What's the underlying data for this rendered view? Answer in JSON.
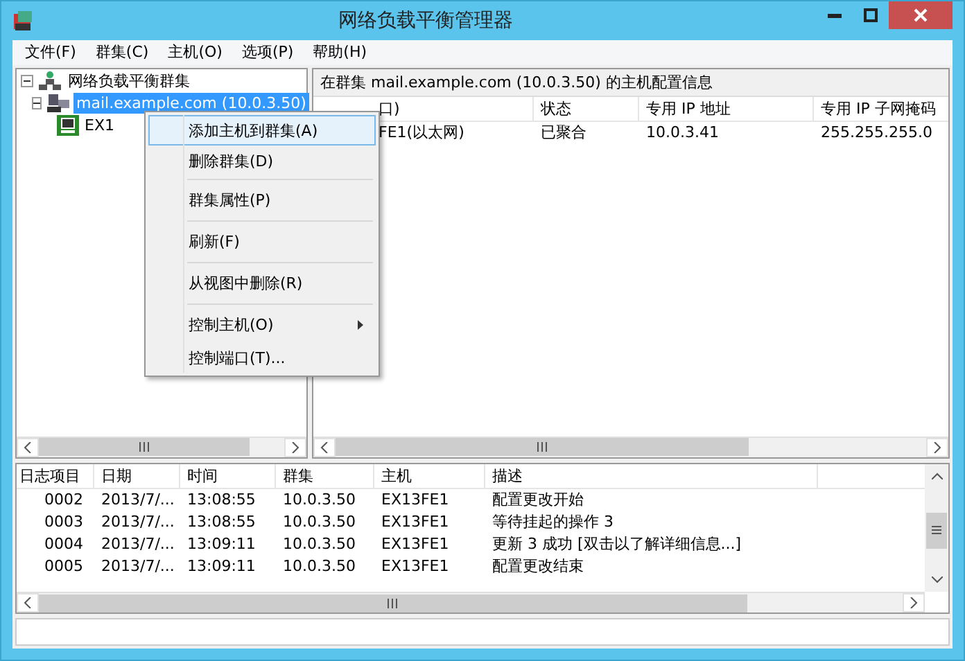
{
  "window": {
    "title": "网络负载平衡管理器"
  },
  "menu_bar": [
    "文件(F)",
    "群集(C)",
    "主机(O)",
    "选项(P)",
    "帮助(H)"
  ],
  "tree": {
    "label": "网络负载平衡群集",
    "expanded": true,
    "children": [
      {
        "label": "mail.example.com (10.0.3.50)",
        "selected": true,
        "expanded": true,
        "children": [
          {
            "label": "EX1",
            "selected": false
          }
        ]
      }
    ]
  },
  "host_panel": {
    "caption": "在群集 mail.example.com (10.0.3.50) 的主机配置信息",
    "columns": [
      "口)",
      "状态",
      "专用 IP 地址",
      "专用 IP 子网掩码"
    ],
    "rows": [
      [
        "FE1(以太网)",
        "已聚合",
        "10.0.3.41",
        "255.255.255.0"
      ]
    ]
  },
  "context_menu": [
    {
      "label": "添加主机到群集(A)",
      "selected": true,
      "separator_before": false,
      "submenu": false
    },
    {
      "label": "删除群集(D)",
      "selected": false,
      "separator_before": false,
      "submenu": false
    },
    {
      "label": "群集属性(P)",
      "selected": false,
      "separator_before": true,
      "submenu": false
    },
    {
      "label": "刷新(F)",
      "selected": false,
      "separator_before": true,
      "submenu": false
    },
    {
      "label": "从视图中删除(R)",
      "selected": false,
      "separator_before": true,
      "submenu": false
    },
    {
      "label": "控制主机(O)",
      "selected": false,
      "separator_before": true,
      "submenu": true
    },
    {
      "label": "控制端口(T)...",
      "selected": false,
      "separator_before": false,
      "submenu": false
    }
  ],
  "log": {
    "columns": [
      "日志项目",
      "日期",
      "时间",
      "群集",
      "主机",
      "描述"
    ],
    "rows": [
      [
        "0002",
        "2013/7/...",
        "13:08:55",
        "10.0.3.50",
        "EX13FE1",
        "配置更改开始"
      ],
      [
        "0003",
        "2013/7/...",
        "13:08:55",
        "10.0.3.50",
        "EX13FE1",
        "等待挂起的操作 3"
      ],
      [
        "0004",
        "2013/7/...",
        "13:09:11",
        "10.0.3.50",
        "EX13FE1",
        "更新 3 成功 [双击以了解详细信息...]"
      ],
      [
        "0005",
        "2013/7/...",
        "13:09:11",
        "10.0.3.50",
        "EX13FE1",
        "配置更改结束"
      ]
    ]
  }
}
